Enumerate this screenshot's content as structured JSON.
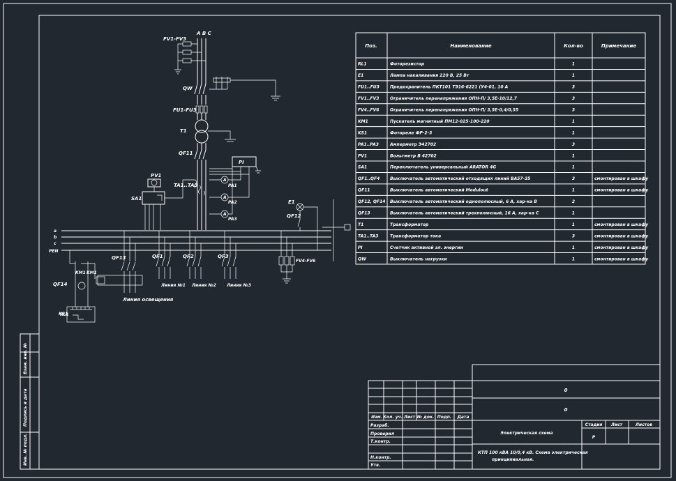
{
  "bom": {
    "headers": [
      "Поз.",
      "Наименование",
      "Кол-во",
      "Примечание"
    ],
    "rows": [
      [
        "RL1",
        "Фоторезистор",
        "1",
        ""
      ],
      [
        "E1",
        "Лампа накаливания 220 В, 25 Вт",
        "1",
        ""
      ],
      [
        "FU1..FU3",
        "Предохранитель ПКТ101 ТЭ16-6221 (У4-01, 10 А",
        "3",
        ""
      ],
      [
        "FV1..FV3",
        "Ограничитель перенапряжения ОПН-П/ 3,5Е-10/12,7",
        "3",
        ""
      ],
      [
        "FV4..FV6",
        "Ограничитель перенапряжения ОПН-П/ 3,5Е-0,4/0,55",
        "3",
        ""
      ],
      [
        "KM1",
        "Пускатель магнитный ПМ12-025-100-220",
        "1",
        ""
      ],
      [
        "KS1",
        "Фотореле ФР-2-3",
        "1",
        ""
      ],
      [
        "PA1..PA3",
        "Амперметр Э42702",
        "3",
        ""
      ],
      [
        "PV1",
        "Вольтметр В 42702",
        "1",
        ""
      ],
      [
        "SA1",
        "Переключатель универсальный ARATOR 4G",
        "1",
        ""
      ],
      [
        "QF1..QF4",
        "Выключатель автоматический отходящих линий ВА57-35",
        "3",
        "смонтирован в шкафу"
      ],
      [
        "QF11",
        "Выключатель автоматический Modulout",
        "1",
        "смонтирован в шкафу"
      ],
      [
        "QF12, QF14",
        "Выключатель автоматический однополюсный, 6 А, хар-ка В",
        "2",
        ""
      ],
      [
        "QF13",
        "Выключатель автоматический трехполюсный, 16 А, хар-ка С",
        "1",
        ""
      ],
      [
        "T1",
        "Трансформатор",
        "1",
        "смонтирован в шкафу"
      ],
      [
        "TA1..TA3",
        "Трансформатор тока",
        "3",
        "смонтирован в шкафу"
      ],
      [
        "PI",
        "Счетчик активной эл. энергии",
        "1",
        "смонтирован в шкафу"
      ],
      [
        "QW",
        "Выключатель нагрузки",
        "1",
        "смонтирован в шкафу"
      ]
    ]
  },
  "schematic": {
    "labels": {
      "fv_top": "FV1-FV3",
      "phases": "A B C",
      "qw": "QW",
      "fu": "FU1-FU3",
      "t1": "T1",
      "qf11": "QF11",
      "pi": "PI",
      "pv1": "PV1",
      "sa1": "SA1",
      "ta": "TA1..TA3",
      "pa1": "PA1",
      "pa2": "PA2",
      "pa3": "PA3",
      "e1": "E1",
      "qf12": "QF12",
      "bus_a": "a",
      "bus_b": "b",
      "bus_c": "c",
      "bus_pen": "PEN",
      "qf13": "QF13",
      "qf1": "QF1",
      "qf2": "QF2",
      "qf3": "QF3",
      "km1_a": "KM1",
      "km1_b": "KM1",
      "qf14": "QF14",
      "rl1": "RL1",
      "ks1": "KS1",
      "fv46": "FV4-FV6",
      "street_light": "Линия освещения",
      "line1": "Линия №1",
      "line2": "Линия №2",
      "line3": "Линия №3"
    }
  },
  "stamp": {
    "code": "0",
    "title": "0",
    "col_labels": [
      "Изм.",
      "Кол. уч.",
      "Лист",
      "№ док.",
      "Подп.",
      "Дата"
    ],
    "roles": [
      "Разраб.",
      "Проверил",
      "Т.контр.",
      "Н.контр.",
      "Утв."
    ],
    "drawing_name": "Электрическая схема",
    "drawing_desc": "КТП 100 кВА 10/0,4 кВ. Схема электрическая принципиальная.",
    "stage_label": "Стадия",
    "sheet_label": "Лист",
    "sheets_label": "Листов",
    "stage_value": "Р"
  },
  "side_stamp": {
    "labels": [
      "Инв. № подл.",
      "Подпись и дата",
      "Взам. инв. №"
    ]
  }
}
